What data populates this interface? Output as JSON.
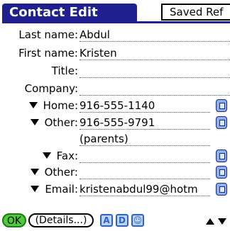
{
  "header": {
    "title": "Contact Edit",
    "saved_ref": "Saved Ref"
  },
  "fields": {
    "last_name": {
      "label": "Last name:",
      "value": "Abdul"
    },
    "first_name": {
      "label": "First name:",
      "value": "Kristen"
    },
    "title": {
      "label": "Title:",
      "value": ""
    },
    "company": {
      "label": "Company:",
      "value": ""
    },
    "home": {
      "label": "Home:",
      "value": "916-555-1140"
    },
    "other1": {
      "label": "Other:",
      "value": "916-555-9791",
      "value_line2": "(parents)"
    },
    "fax": {
      "label": "Fax:",
      "value": ""
    },
    "other2": {
      "label": "Other:",
      "value": ""
    },
    "email": {
      "label": "Email:",
      "value": "kristenabdul99@hotm"
    }
  },
  "footer": {
    "ok_label": "OK",
    "details_label": "(Details...)",
    "icons": [
      "A",
      "D",
      "☺"
    ]
  }
}
